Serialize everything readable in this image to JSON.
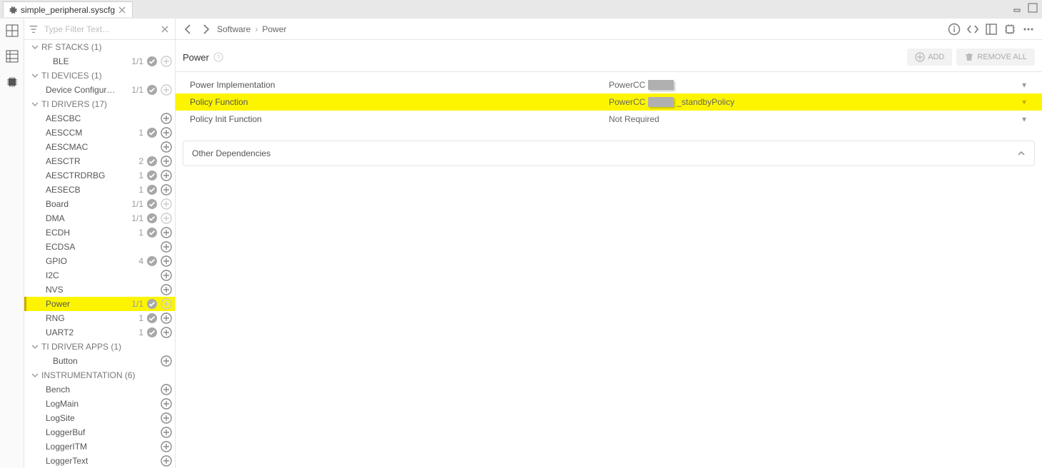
{
  "tab": {
    "title": "simple_peripheral.syscfg"
  },
  "filter": {
    "placeholder": "Type Filter Text..."
  },
  "tree": {
    "groups": [
      {
        "name": "RF STACKS (1)",
        "items": [
          {
            "label": "BLE",
            "count": "1/1",
            "check": true,
            "plus": true,
            "plusDisabled": true,
            "sub": true
          }
        ]
      },
      {
        "name": "TI DEVICES (1)",
        "items": [
          {
            "label": "Device Configur…",
            "count": "1/1",
            "check": true,
            "plus": true,
            "plusDisabled": true
          }
        ]
      },
      {
        "name": "TI DRIVERS (17)",
        "items": [
          {
            "label": "AESCBC",
            "count": "",
            "check": false,
            "plus": true
          },
          {
            "label": "AESCCM",
            "count": "1",
            "check": true,
            "plus": true
          },
          {
            "label": "AESCMAC",
            "count": "",
            "check": false,
            "plus": true
          },
          {
            "label": "AESCTR",
            "count": "2",
            "check": true,
            "plus": true
          },
          {
            "label": "AESCTRDRBG",
            "count": "1",
            "check": true,
            "plus": true
          },
          {
            "label": "AESECB",
            "count": "1",
            "check": true,
            "plus": true
          },
          {
            "label": "Board",
            "count": "1/1",
            "check": true,
            "plus": true,
            "plusDisabled": true
          },
          {
            "label": "DMA",
            "count": "1/1",
            "check": true,
            "plus": true,
            "plusDisabled": true
          },
          {
            "label": "ECDH",
            "count": "1",
            "check": true,
            "plus": true
          },
          {
            "label": "ECDSA",
            "count": "",
            "check": false,
            "plus": true
          },
          {
            "label": "GPIO",
            "count": "4",
            "check": true,
            "plus": true
          },
          {
            "label": "I2C",
            "count": "",
            "check": false,
            "plus": true
          },
          {
            "label": "NVS",
            "count": "",
            "check": false,
            "plus": true
          },
          {
            "label": "Power",
            "count": "1/1",
            "check": true,
            "plus": true,
            "plusDisabled": true,
            "selected": true
          },
          {
            "label": "RNG",
            "count": "1",
            "check": true,
            "plus": true
          },
          {
            "label": "UART2",
            "count": "1",
            "check": true,
            "plus": true
          }
        ]
      },
      {
        "name": "TI DRIVER APPS (1)",
        "items": [
          {
            "label": "Button",
            "count": "",
            "check": false,
            "plus": true,
            "sub": true
          }
        ]
      },
      {
        "name": "INSTRUMENTATION (6)",
        "items": [
          {
            "label": "Bench",
            "count": "",
            "check": false,
            "plus": true
          },
          {
            "label": "LogMain",
            "count": "",
            "check": false,
            "plus": true
          },
          {
            "label": "LogSite",
            "count": "",
            "check": false,
            "plus": true
          },
          {
            "label": "LoggerBuf",
            "count": "",
            "check": false,
            "plus": true
          },
          {
            "label": "LoggerITM",
            "count": "",
            "check": false,
            "plus": true
          },
          {
            "label": "LoggerText",
            "count": "",
            "check": false,
            "plus": true
          }
        ]
      }
    ]
  },
  "breadcrumb": {
    "a": "Software",
    "b": "Power"
  },
  "page": {
    "title": "Power",
    "addLabel": "ADD",
    "removeLabel": "REMOVE ALL",
    "depTitle": "Other Dependencies"
  },
  "props": [
    {
      "label": "Power Implementation",
      "valPrefix": "PowerCC",
      "valSuffix": "",
      "redacted": true,
      "hl": false
    },
    {
      "label": "Policy Function",
      "valPrefix": "PowerCC",
      "valSuffix": "_standbyPolicy",
      "redacted": true,
      "hl": true
    },
    {
      "label": "Policy Init Function",
      "valPrefix": "Not Required",
      "valSuffix": "",
      "redacted": false,
      "hl": false
    }
  ]
}
